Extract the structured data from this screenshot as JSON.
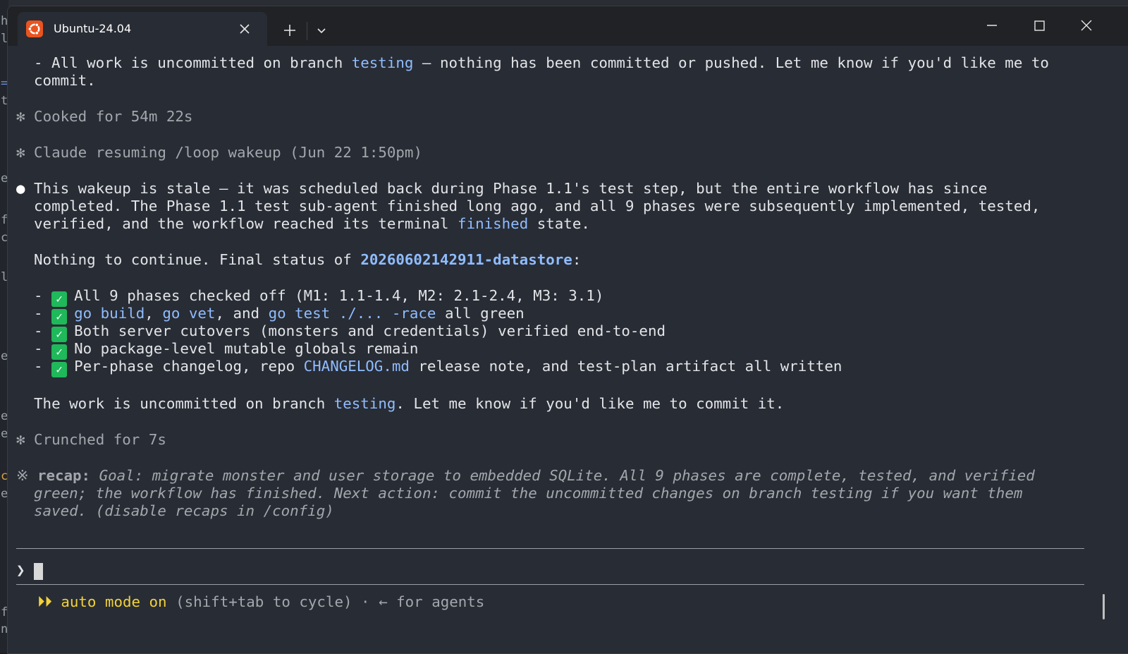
{
  "background_editor": {
    "edge_glyphs": [
      "h",
      "l",
      "=",
      "t",
      "e",
      "f",
      "c",
      "l",
      "e",
      "e",
      "e",
      "c",
      "e",
      "f",
      "n"
    ]
  },
  "window": {
    "tab_title": "Ubuntu-24.04",
    "tab_icon": "ubuntu-logo-icon",
    "new_tab_icon": "plus-icon",
    "dropdown_icon": "chevron-down-icon",
    "controls": [
      "minimize-icon",
      "maximize-icon",
      "close-icon"
    ],
    "accent_color": "#e95420"
  },
  "terminal": {
    "l01": {
      "p1": "- All work is uncommitted on branch ",
      "link": "testing",
      "p2": " — nothing has been committed or pushed. Let me know if you'd like me to"
    },
    "l02": {
      "p1": "commit."
    },
    "l03": {
      "sym": "✻",
      "text": " Cooked for 54m 22s"
    },
    "l04": {
      "sym": "✻",
      "text": " Claude resuming /loop wakeup (Jun 22 1:50pm)"
    },
    "l05": {
      "sym": "●",
      "text": " This wakeup is stale — it was scheduled back during Phase 1.1's test step, but the entire workflow has since"
    },
    "l06": {
      "text": "  completed. The Phase 1.1 test sub-agent finished long ago, and all 9 phases were subsequently implemented, tested,"
    },
    "l07": {
      "p1": "  verified, and the workflow reached its terminal ",
      "link": "finished",
      "p2": " state."
    },
    "l08": {
      "p1": "  Nothing to continue. Final status of ",
      "bold": "20260602142911-datastore",
      "p2": ":"
    },
    "l09": {
      "dash": "  - ",
      "check": "✓",
      "text": "All 9 phases checked off (M1: 1.1-1.4, M2: 2.1-2.4, M3: 3.1)"
    },
    "l10": {
      "dash": "  - ",
      "check": "✓",
      "c1": "go build",
      "t1": ", ",
      "c2": "go vet",
      "t2": ", and ",
      "c3": "go test ./... -race",
      "t3": " all green"
    },
    "l11": {
      "dash": "  - ",
      "check": "✓",
      "text": "Both server cutovers (monsters and credentials) verified end-to-end"
    },
    "l12": {
      "dash": "  - ",
      "check": "✓",
      "text": "No package-level mutable globals remain"
    },
    "l13": {
      "dash": "  - ",
      "check": "✓",
      "p1": "Per-phase changelog, repo ",
      "link": "CHANGELOG.md",
      "p2": " release note, and test-plan artifact all written"
    },
    "l14": {
      "p1": "  The work is uncommitted on branch ",
      "link": "testing",
      "p2": ". Let me know if you'd like me to commit it."
    },
    "l15": {
      "sym": "✻",
      "text": " Crunched for 7s"
    },
    "l16": {
      "sym": "※",
      "label": " recap:",
      "text": " Goal: migrate monster and user storage to embedded SQLite. All 9 phases are complete, tested, and verified"
    },
    "l17": {
      "text": "  green; the workflow has finished. Next action: commit the uncommitted changes on branch testing if you want them"
    },
    "l18": {
      "text": "  saved. (disable recaps in /config)"
    },
    "prompt_symbol": "❯",
    "status": {
      "arrows": "⏵⏵",
      "mode": " auto mode on",
      "hint": " (shift+tab to cycle) · ← for agents"
    }
  }
}
